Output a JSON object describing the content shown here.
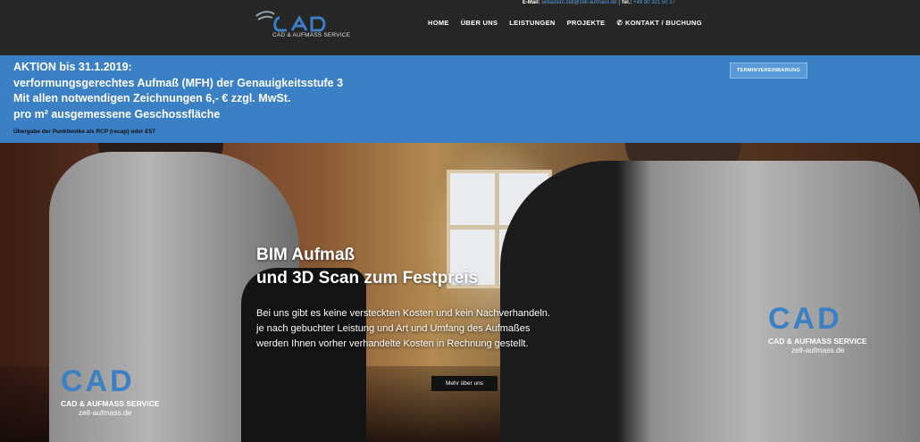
{
  "topbar": {
    "email_label": "E-Mail:",
    "email": "sebastian.zell@zell-aufmass.de",
    "sep": " | ",
    "tel_label": "Tel.:",
    "tel": "+49 30 321 50 17"
  },
  "logo": {
    "mark": "CAD",
    "subtitle": "CAD & AUFMASS SERVICE"
  },
  "nav": {
    "items": [
      "HOME",
      "ÜBER UNS",
      "LEISTUNGEN",
      "PROJEKTE"
    ],
    "contact": "KONTAKT / BUCHUNG",
    "contact_icon": "phone-icon"
  },
  "banner": {
    "lines": [
      "AKTION bis 31.1.2019:",
      "verformungsgerechtes Aufmaß (MFH) der Genauigkeitsstufe 3",
      "Mit allen notwendigen Zeichnungen 6,- € zzgl. MwSt.",
      "pro m² ausgemessene Geschossfläche"
    ],
    "small": "Übergabe der Punktwolke als RCP (recap) oder E57",
    "cta": "TERMINVEREINBARUNG",
    "color": "#3b7fc4"
  },
  "hero": {
    "title_line1": "BIM Aufmaß",
    "title_line2": "und 3D Scan zum Festpreis",
    "text": [
      "Bei uns gibt es keine versteckten Kosten und kein Nachverhandeln.",
      "je nach gebuchter Leistung und Art und Umfang des Aufmaßes",
      "werden Ihnen vorher verhandelte Kosten in Rechnung gestellt."
    ],
    "button": "Mehr über uns",
    "jacket_left": {
      "mark": "CAD",
      "line1": "CAD & AUFMASS SERVICE",
      "line2": "zell-aufmass.de"
    },
    "jacket_right": {
      "mark": "CAD",
      "line1": "CAD & AUFMASS SERVICE",
      "line2": "zell-aufmass.de"
    }
  }
}
